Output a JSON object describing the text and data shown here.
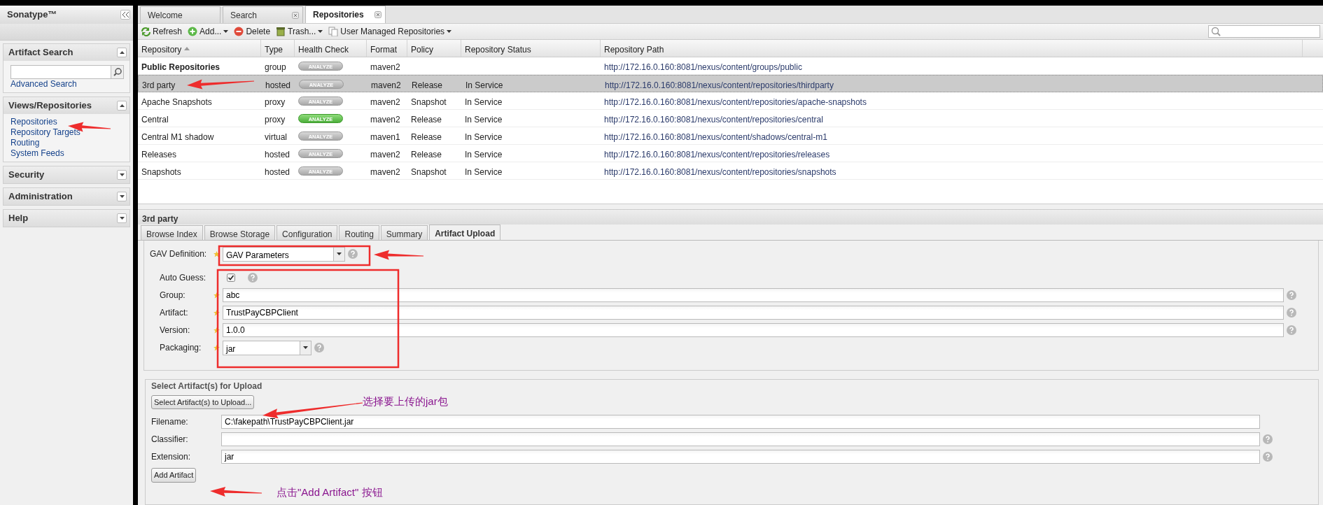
{
  "sidebar": {
    "title": "Sonatype™",
    "panels": [
      {
        "title": "Artifact Search",
        "expanded": true,
        "search": true,
        "links": [
          {
            "label": "Advanced Search"
          }
        ]
      },
      {
        "title": "Views/Repositories",
        "expanded": true,
        "links": [
          {
            "label": "Repositories"
          },
          {
            "label": "Repository Targets"
          },
          {
            "label": "Routing"
          },
          {
            "label": "System Feeds"
          }
        ]
      },
      {
        "title": "Security",
        "expanded": false
      },
      {
        "title": "Administration",
        "expanded": false
      },
      {
        "title": "Help",
        "expanded": false
      }
    ]
  },
  "tabs": [
    {
      "label": "Welcome",
      "selected": false,
      "closable": false
    },
    {
      "label": "Search",
      "selected": false,
      "closable": true
    },
    {
      "label": "Repositories",
      "selected": true,
      "closable": true
    }
  ],
  "toolbar": [
    {
      "label": "Refresh",
      "menu": false
    },
    {
      "label": "Add...",
      "menu": true
    },
    {
      "label": "Delete",
      "menu": false
    },
    {
      "label": "Trash...",
      "menu": true
    },
    {
      "label": "User Managed Repositories",
      "menu": true
    }
  ],
  "table": {
    "columns": [
      {
        "label": "Repository",
        "sorted": true
      },
      {
        "label": "Type",
        "sorted": false
      },
      {
        "label": "Health Check",
        "sorted": false
      },
      {
        "label": "Format",
        "sorted": false
      },
      {
        "label": "Policy",
        "sorted": false
      },
      {
        "label": "Repository Status",
        "sorted": false
      },
      {
        "label": "Repository Path",
        "sorted": false
      }
    ],
    "rows": [
      {
        "name": "Public Repositories",
        "bold": true,
        "selected": false,
        "type": "group",
        "health": "ANALYZE",
        "health_active": false,
        "format": "maven2",
        "path": "http://172.16.0.160:8081/nexus/content/groups/public"
      },
      {
        "name": "3rd party",
        "bold": false,
        "selected": true,
        "type": "hosted",
        "health": "ANALYZE",
        "health_active": false,
        "format": "maven2",
        "policy": "Release",
        "status": "In Service",
        "path": "http://172.16.0.160:8081/nexus/content/repositories/thirdparty"
      },
      {
        "name": "Apache Snapshots",
        "bold": false,
        "selected": false,
        "type": "proxy",
        "health": "ANALYZE",
        "health_active": false,
        "format": "maven2",
        "policy": "Snapshot",
        "status": "In Service",
        "path": "http://172.16.0.160:8081/nexus/content/repositories/apache-snapshots"
      },
      {
        "name": "Central",
        "bold": false,
        "selected": false,
        "type": "proxy",
        "health": "ANALYZE",
        "health_active": true,
        "format": "maven2",
        "policy": "Release",
        "status": "In Service",
        "path": "http://172.16.0.160:8081/nexus/content/repositories/central"
      },
      {
        "name": "Central M1 shadow",
        "bold": false,
        "selected": false,
        "type": "virtual",
        "health": "ANALYZE",
        "health_active": false,
        "format": "maven1",
        "policy": "Release",
        "status": "In Service",
        "path": "http://172.16.0.160:8081/nexus/content/shadows/central-m1"
      },
      {
        "name": "Releases",
        "bold": false,
        "selected": false,
        "type": "hosted",
        "health": "ANALYZE",
        "health_active": false,
        "format": "maven2",
        "policy": "Release",
        "status": "In Service",
        "path": "http://172.16.0.160:8081/nexus/content/repositories/releases"
      },
      {
        "name": "Snapshots",
        "bold": false,
        "selected": false,
        "type": "hosted",
        "health": "ANALYZE",
        "health_active": false,
        "format": "maven2",
        "policy": "Snapshot",
        "status": "In Service",
        "path": "http://172.16.0.160:8081/nexus/content/repositories/snapshots"
      }
    ]
  },
  "detail": {
    "title": "3rd party",
    "tabs": [
      {
        "label": "Browse Index",
        "selected": false
      },
      {
        "label": "Browse Storage",
        "selected": false
      },
      {
        "label": "Configuration",
        "selected": false
      },
      {
        "label": "Routing",
        "selected": false
      },
      {
        "label": "Summary",
        "selected": false
      },
      {
        "label": "Artifact Upload",
        "selected": true
      }
    ],
    "gav": {
      "label": "GAV Definition:",
      "value": "GAV Parameters",
      "required": true
    },
    "fields": [
      {
        "kind": "checkbox",
        "label": "Auto Guess:",
        "checked": true,
        "required": false
      },
      {
        "kind": "text",
        "label": "Group:",
        "value": "abc",
        "required": true
      },
      {
        "kind": "text",
        "label": "Artifact:",
        "value": "TrustPayCBPClient",
        "required": true
      },
      {
        "kind": "text",
        "label": "Version:",
        "value": "1.0.0",
        "required": true
      },
      {
        "kind": "select",
        "label": "Packaging:",
        "value": "jar",
        "required": true
      }
    ]
  },
  "upload": {
    "legend": "Select Artifact(s) for Upload",
    "select_button": "Select Artifact(s) to Upload...",
    "fields": [
      {
        "label": "Filename:",
        "value": "C:\\fakepath\\TrustPayCBPClient.jar",
        "help": false
      },
      {
        "label": "Classifier:",
        "help": true
      },
      {
        "label": "Extension:",
        "value": "jar",
        "help": true
      }
    ],
    "add_button": "Add Artifact"
  },
  "annotations": [
    "选择要上传的jar包",
    "点击\"Add Artifact\" 按钮"
  ]
}
